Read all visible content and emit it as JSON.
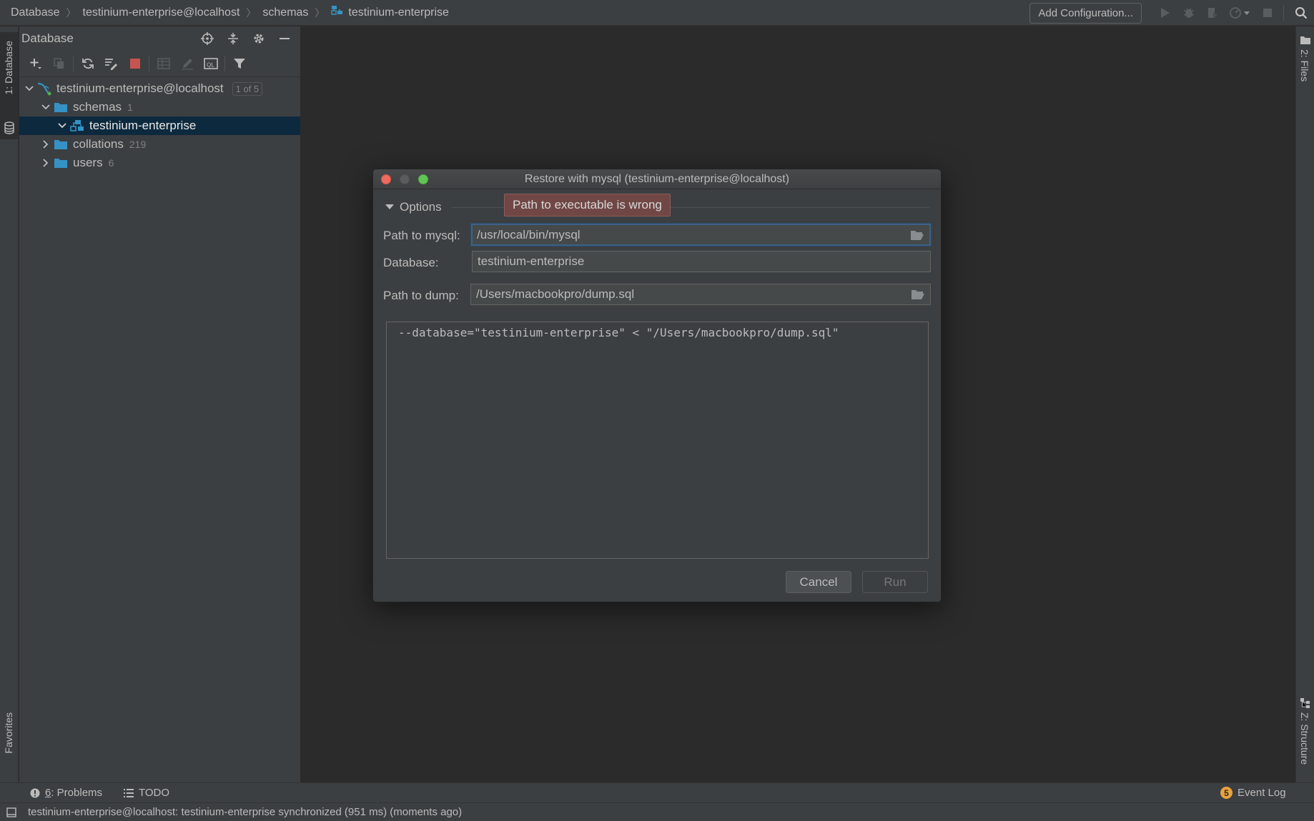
{
  "navbar": {
    "crumbs": [
      "Database",
      "testinium-enterprise@localhost",
      "schemas",
      "testinium-enterprise"
    ],
    "add_config_label": "Add Configuration..."
  },
  "left_stripe": {
    "database_tab": "1: Database",
    "favorites_tab": "Favorites"
  },
  "right_stripe": {
    "files_tab": "2: Files",
    "structure_tab": "Z: Structure"
  },
  "db_panel": {
    "title": "Database",
    "tree": [
      {
        "label": "testinium-enterprise@localhost",
        "badge": "1 of 5"
      },
      {
        "label": "schemas",
        "count": "1"
      },
      {
        "label": "testinium-enterprise"
      },
      {
        "label": "collations",
        "count": "219"
      },
      {
        "label": "users",
        "count": "6"
      }
    ]
  },
  "dialog": {
    "title": "Restore with mysql (testinium-enterprise@localhost)",
    "options_label": "Options",
    "error_tooltip": "Path to executable is wrong",
    "path_mysql_label": "Path to mysql:",
    "path_mysql_value": "/usr/local/bin/mysql",
    "database_label": "Database:",
    "database_value": "testinium-enterprise",
    "path_dump_label": "Path to dump:",
    "path_dump_value": "/Users/macbookpro/dump.sql",
    "command_preview": "--database=\"testinium-enterprise\" < \"/Users/macbookpro/dump.sql\"",
    "cancel_label": "Cancel",
    "run_label": "Run"
  },
  "toolwin_bar": {
    "problems_num": "6",
    "problems_label": ": Problems",
    "todo_label": "TODO",
    "event_log_badge": "5",
    "event_log_label": "Event Log"
  },
  "status_bar": {
    "message": "testinium-enterprise@localhost: testinium-enterprise synchronized (951 ms) (moments ago)"
  },
  "colors": {
    "accent_blue": "#3592c4",
    "stop_red": "#c75450",
    "selection": "#0d293e",
    "error_bg": "#704745",
    "badge_orange": "#e8a33d"
  }
}
